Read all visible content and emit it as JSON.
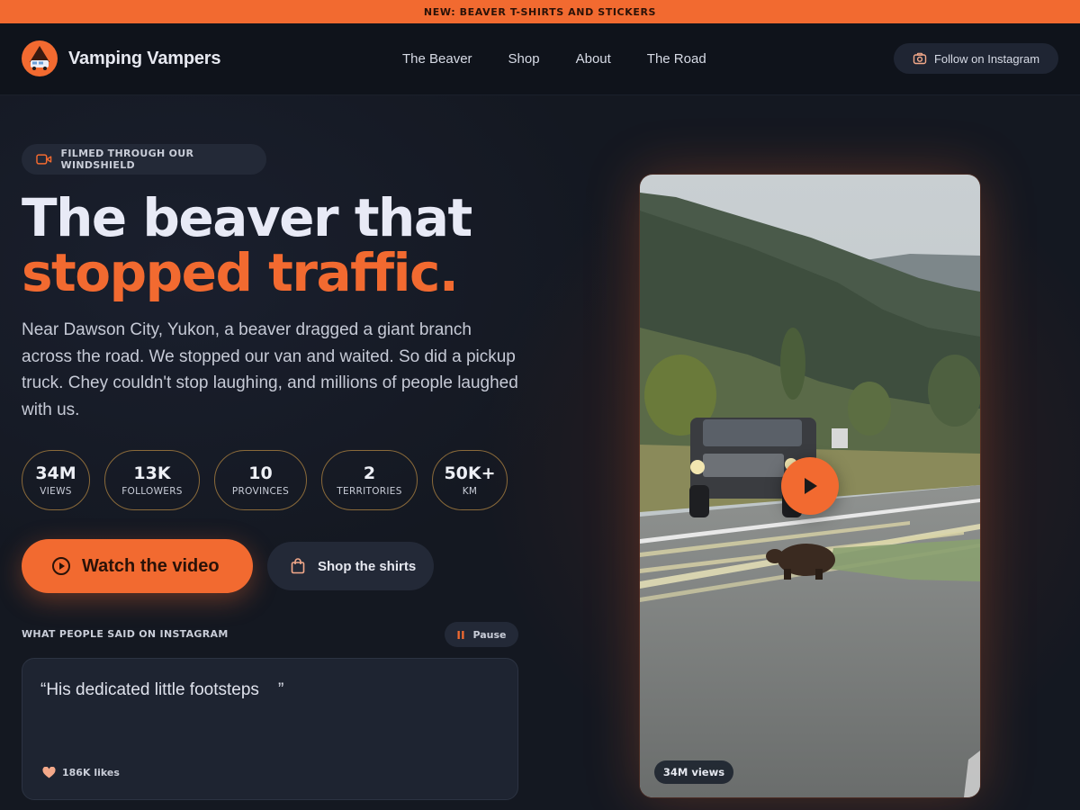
{
  "announcement": "NEW: BEAVER T-SHIRTS AND STICKERS",
  "brand": {
    "name": "Vamping Vampers"
  },
  "nav": {
    "links": [
      "The Beaver",
      "Shop",
      "About",
      "The Road"
    ],
    "instagram_button": "Follow on Instagram"
  },
  "hero": {
    "badge": "FILMED THROUGH OUR WINDSHIELD",
    "title_line1": "The beaver that",
    "title_line2": "stopped traffic.",
    "description": "Near Dawson City, Yukon, a beaver dragged a giant branch across the road. We stopped our van and waited. So did a pickup truck. Chey couldn't stop laughing, and millions of people laughed with us."
  },
  "stats": [
    {
      "value": "34M",
      "label": "VIEWS"
    },
    {
      "value": "13K",
      "label": "FOLLOWERS"
    },
    {
      "value": "10",
      "label": "PROVINCES"
    },
    {
      "value": "2",
      "label": "TERRITORIES"
    },
    {
      "value": "50K+",
      "label": "KM"
    }
  ],
  "buttons": {
    "watch": "Watch the video",
    "shop": "Shop the shirts"
  },
  "testimonials": {
    "heading": "WHAT PEOPLE SAID ON INSTAGRAM",
    "pause_label": "Pause",
    "quote": "“His dedicated little footsteps    ”",
    "likes": "186K likes"
  },
  "video": {
    "views": "34M views"
  },
  "icons": {
    "logo": "van-logo-icon",
    "instagram": "camera-icon",
    "badge": "video-camera-icon",
    "watch": "play-circle-icon",
    "shop": "shopping-bag-icon",
    "pause": "pause-icon",
    "likes": "heart-icon",
    "play": "play-icon"
  },
  "colors": {
    "accent": "#f26a30",
    "background": "#141821",
    "stat_border": "#8a6a3a",
    "heart": "#f4a98a"
  }
}
